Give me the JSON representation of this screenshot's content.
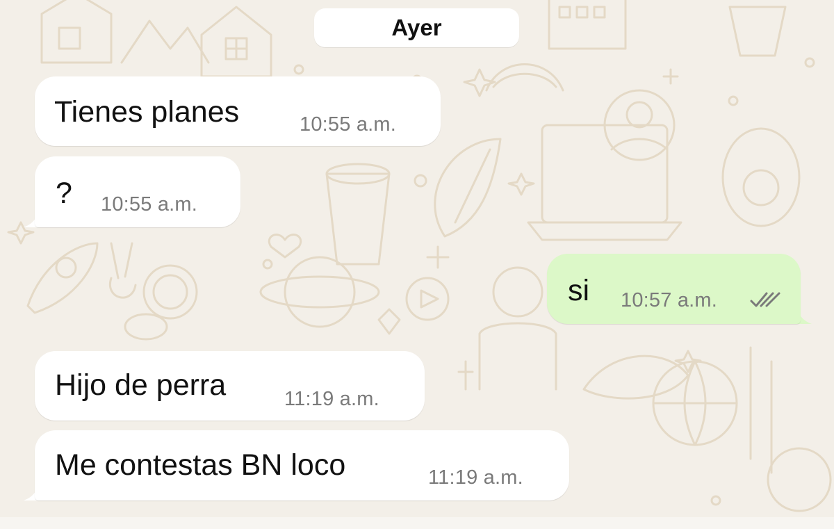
{
  "date_separator": "Ayer",
  "messages": [
    {
      "direction": "incoming",
      "text": "Tienes planes",
      "time": "10:55 a.m."
    },
    {
      "direction": "incoming",
      "text": "?",
      "time": "10:55 a.m."
    },
    {
      "direction": "outgoing",
      "text": "si",
      "time": "10:57 a.m.",
      "status_icon": "double-check-icon"
    },
    {
      "direction": "incoming",
      "text": "Hijo de perra",
      "time": "11:19 a.m."
    },
    {
      "direction": "incoming",
      "text": "Me contestas BN loco",
      "time": "11:19 a.m."
    }
  ],
  "colors": {
    "wallpaper": "#f3efe8",
    "doodle": "#e6dccb",
    "incoming_bubble": "#ffffff",
    "outgoing_bubble": "#dcf8c8",
    "timestamp": "#7a7a7a",
    "read_ticks": "#7a7a7a"
  }
}
